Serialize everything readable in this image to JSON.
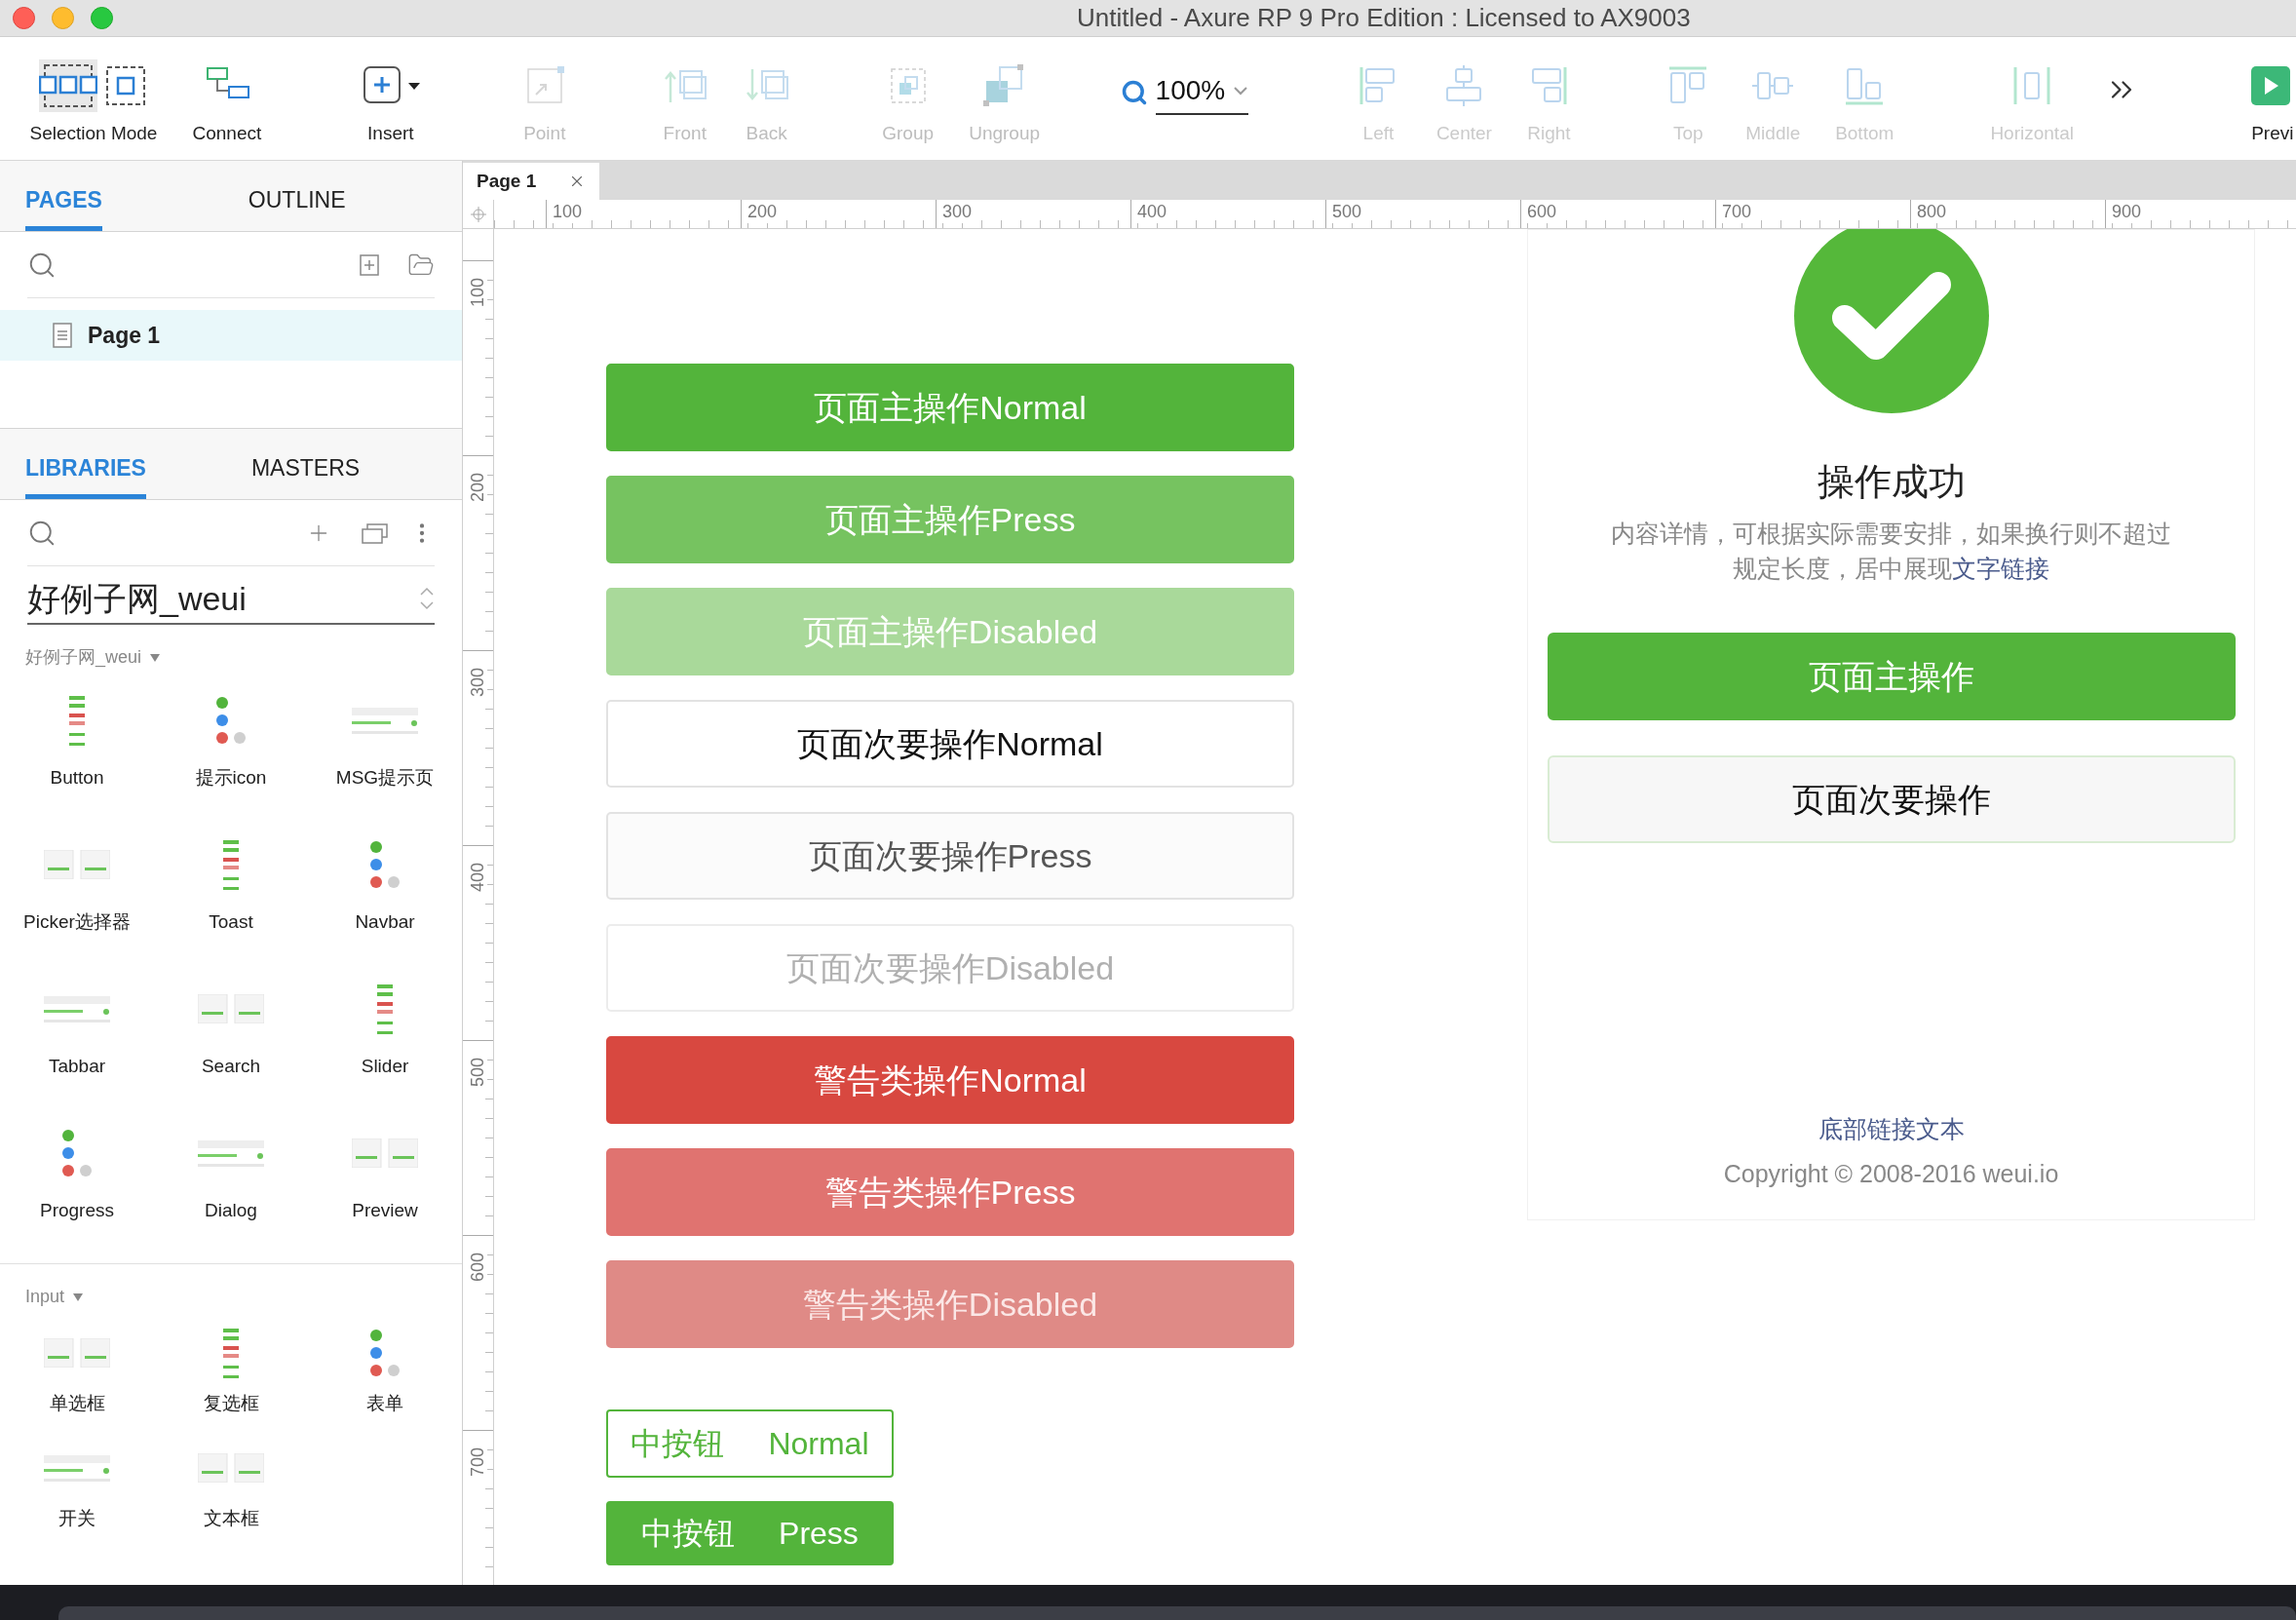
{
  "window": {
    "title": "Untitled - Axure RP 9 Pro Edition : Licensed to AX9003"
  },
  "toolbar": {
    "modes": [
      {
        "label": "Selection Mode",
        "selected": true
      },
      {
        "label": "Connect",
        "selected": false
      }
    ],
    "tools": [
      {
        "label": "Insert",
        "disabled": false
      },
      {
        "label": "Point",
        "disabled": true
      },
      {
        "label": "Front",
        "disabled": true
      },
      {
        "label": "Back",
        "disabled": true
      },
      {
        "label": "Group",
        "disabled": true
      },
      {
        "label": "Ungroup",
        "disabled": true
      }
    ],
    "zoom": "100%",
    "align_tools": [
      {
        "label": "Left",
        "disabled": true
      },
      {
        "label": "Center",
        "disabled": true
      },
      {
        "label": "Right",
        "disabled": true
      },
      {
        "label": "Top",
        "disabled": true
      },
      {
        "label": "Middle",
        "disabled": true
      },
      {
        "label": "Bottom",
        "disabled": true
      },
      {
        "label": "Horizontal",
        "disabled": true
      }
    ],
    "preview": "Previ"
  },
  "pages_panel": {
    "tabs": [
      {
        "label": "PAGES",
        "selected": true
      },
      {
        "label": "OUTLINE",
        "selected": false
      }
    ],
    "pages": [
      {
        "name": "Page 1",
        "selected": true
      }
    ]
  },
  "libraries_panel": {
    "tabs": [
      {
        "label": "LIBRARIES",
        "selected": true
      },
      {
        "label": "MASTERS",
        "selected": false
      }
    ],
    "library": "好例子网_weui",
    "sections": [
      {
        "title": "好例子网_weui",
        "expanded": true,
        "widgets": [
          "Button",
          "提示icon",
          "MSG提示页",
          "Picker选择器",
          "Toast",
          "Navbar",
          "Tabbar",
          "Search",
          "Slider",
          "Progress",
          "Dialog",
          "Preview"
        ]
      },
      {
        "title": "Input",
        "expanded": true,
        "widgets": [
          "单选框",
          "复选框",
          "表单",
          "开关",
          "文本框"
        ]
      }
    ]
  },
  "document_tabs": [
    {
      "label": "Page 1"
    }
  ],
  "ruler": {
    "x_marks": [
      "100",
      "200",
      "300",
      "400",
      "500",
      "600",
      "700",
      "800",
      "900"
    ],
    "y_marks": [
      "100",
      "200",
      "300",
      "400",
      "500",
      "600",
      "700"
    ]
  },
  "canvas": {
    "buttons": [
      {
        "label": "页面主操作Normal",
        "kind": "primary",
        "pressed": false,
        "disabled": false
      },
      {
        "label": "页面主操作Press",
        "kind": "primary",
        "pressed": true,
        "disabled": false
      },
      {
        "label": "页面主操作Disabled",
        "kind": "primary",
        "pressed": false,
        "disabled": true
      },
      {
        "label": "页面次要操作Normal",
        "kind": "default",
        "pressed": false,
        "disabled": false
      },
      {
        "label": "页面次要操作Press",
        "kind": "default",
        "pressed": true,
        "disabled": false
      },
      {
        "label": "页面次要操作Disabled",
        "kind": "default",
        "pressed": false,
        "disabled": true
      },
      {
        "label": "警告类操作Normal",
        "kind": "warn",
        "pressed": false,
        "disabled": false
      },
      {
        "label": "警告类操作Press",
        "kind": "warn",
        "pressed": true,
        "disabled": false
      },
      {
        "label": "警告类操作Disabled",
        "kind": "warn",
        "pressed": false,
        "disabled": true
      }
    ],
    "small_buttons": [
      {
        "label": "中按钮 Normal",
        "pressed": false
      },
      {
        "label": "中按钮 Press",
        "pressed": true
      }
    ],
    "msg_page": {
      "title": "操作成功",
      "description": "内容详情，可根据实际需要安排，如果换行则不超过规定长度，居中展现",
      "description_link": "文字链接",
      "buttons": [
        {
          "label": "页面主操作",
          "kind": "primary"
        },
        {
          "label": "页面次要操作",
          "kind": "default"
        }
      ],
      "footer_link": "底部链接文本",
      "copyright": "Copyright © 2008-2016 weui.io"
    }
  }
}
